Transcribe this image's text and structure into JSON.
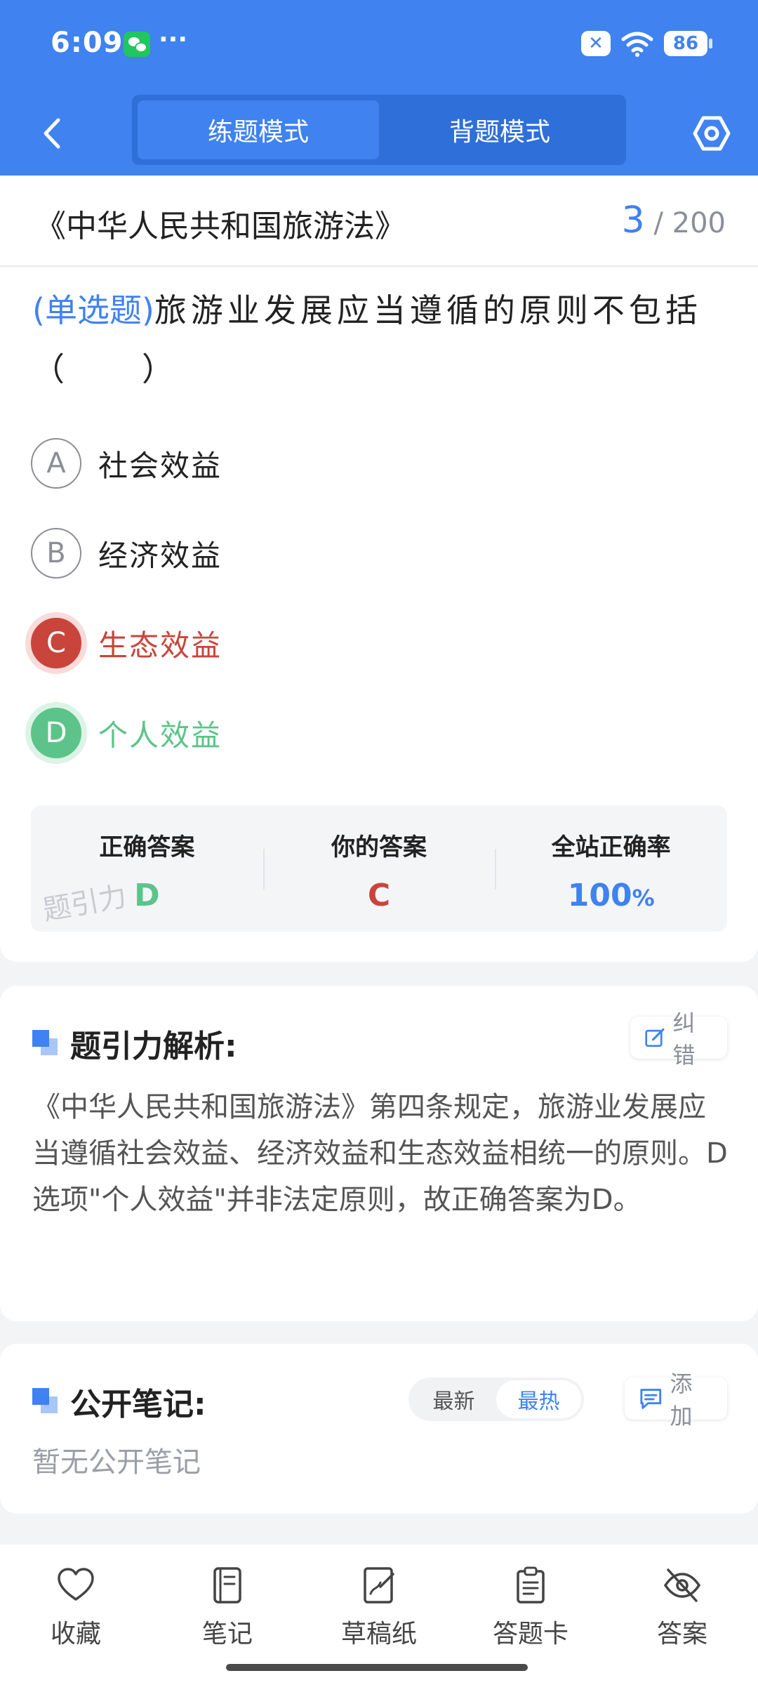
{
  "status_bar": {
    "time": "6:09",
    "more": "···",
    "battery": "86",
    "icons": [
      "wechat-icon",
      "close-icon",
      "wifi-icon",
      "battery-icon"
    ]
  },
  "nav": {
    "tabs": [
      {
        "label": "练题模式",
        "active": true
      },
      {
        "label": "背题模式",
        "active": false
      }
    ],
    "icons": [
      "back-chevron-icon",
      "settings-hexagon-icon"
    ]
  },
  "question": {
    "book": "《中华人民共和国旅游法》",
    "current": "3",
    "total": "/ 200",
    "type": "(单选题)",
    "text": "旅游业发展应当遵循的原则不包括（　　）",
    "options": [
      {
        "letter": "A",
        "text": "社会效益",
        "state": "normal"
      },
      {
        "letter": "B",
        "text": "经济效益",
        "state": "normal"
      },
      {
        "letter": "C",
        "text": "生态效益",
        "state": "wrong"
      },
      {
        "letter": "D",
        "text": "个人效益",
        "state": "correct"
      }
    ]
  },
  "answer": {
    "correct_label": "正确答案",
    "correct_value": "D",
    "yours_label": "你的答案",
    "yours_value": "C",
    "rate_label": "全站正确率",
    "rate_value": "100",
    "rate_unit": "%",
    "watermark": "题引力"
  },
  "analysis": {
    "title": "题引力解析:",
    "report_label": "纠错",
    "text": "《中华人民共和国旅游法》第四条规定，旅游业发展应当遵循社会效益、经济效益和生态效益相统一的原则。D选项\"个人效益\"并非法定原则，故正确答案为D。"
  },
  "notes": {
    "title": "公开笔记:",
    "sort_options": [
      {
        "label": "最新",
        "active": false
      },
      {
        "label": "最热",
        "active": true
      }
    ],
    "add_label": "添加",
    "empty_text": "暂无公开笔记"
  },
  "bottom_bar": {
    "items": [
      {
        "label": "收藏",
        "icon": "heart-icon"
      },
      {
        "label": "笔记",
        "icon": "notebook-icon"
      },
      {
        "label": "草稿纸",
        "icon": "draft-paper-icon"
      },
      {
        "label": "答题卡",
        "icon": "answer-sheet-icon"
      },
      {
        "label": "答案",
        "icon": "eye-hidden-icon"
      }
    ]
  },
  "colors": {
    "brand_blue": "#3f82f0",
    "wrong_red": "#c9453c",
    "correct_green": "#5cc48a"
  }
}
